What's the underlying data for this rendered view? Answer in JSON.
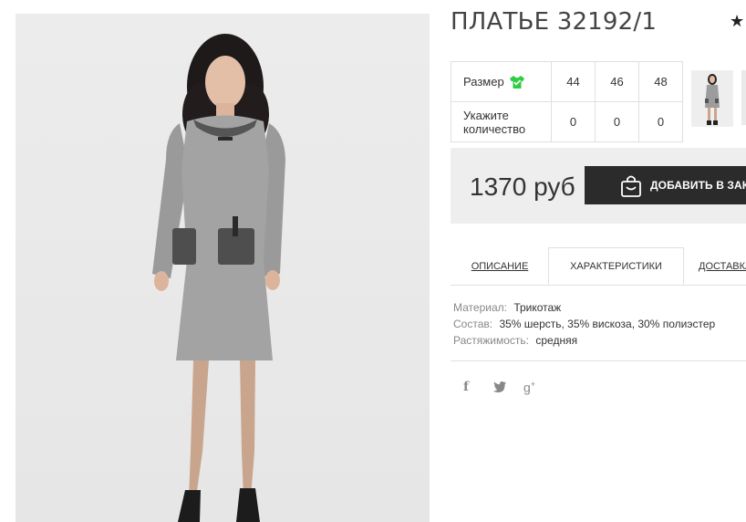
{
  "product": {
    "title": "ПЛАТЬЕ 32192/1",
    "favorite_icon": "star-icon"
  },
  "sizes_table": {
    "size_label": "Размер",
    "size_icon": "tshirt-icon",
    "sizes": [
      "44",
      "46",
      "48"
    ],
    "qty_label_line1": "Укажите",
    "qty_label_line2": "количество",
    "quantities": [
      "0",
      "0",
      "0"
    ]
  },
  "price": {
    "value": "1370 руб",
    "cart_button_label": "ДОБАВИТЬ В ЗАКАЗ",
    "cart_icon": "shopping-bag-icon"
  },
  "tabs": [
    {
      "label": "ОПИСАНИЕ",
      "active": false
    },
    {
      "label": "ХАРАКТЕРИСТИКИ",
      "active": true
    },
    {
      "label": "ДОСТАВКА",
      "active": false
    }
  ],
  "characteristics": [
    {
      "key": "Материал:",
      "value": "Трикотаж"
    },
    {
      "key": "Состав:",
      "value": "35% шерсть, 35% вискоза, 30% полиэстер"
    },
    {
      "key": "Растяжимость:",
      "value": "средняя"
    }
  ],
  "social": [
    {
      "glyph": "f",
      "icon": "facebook-icon"
    },
    {
      "glyph": "🐦",
      "icon": "twitter-icon"
    },
    {
      "glyph": "g+",
      "icon": "google-plus-icon"
    }
  ],
  "colors": {
    "button_bg": "#2b2b2b",
    "price_box_bg": "#eeeeee",
    "size_icon_green": "#2ecc40"
  }
}
